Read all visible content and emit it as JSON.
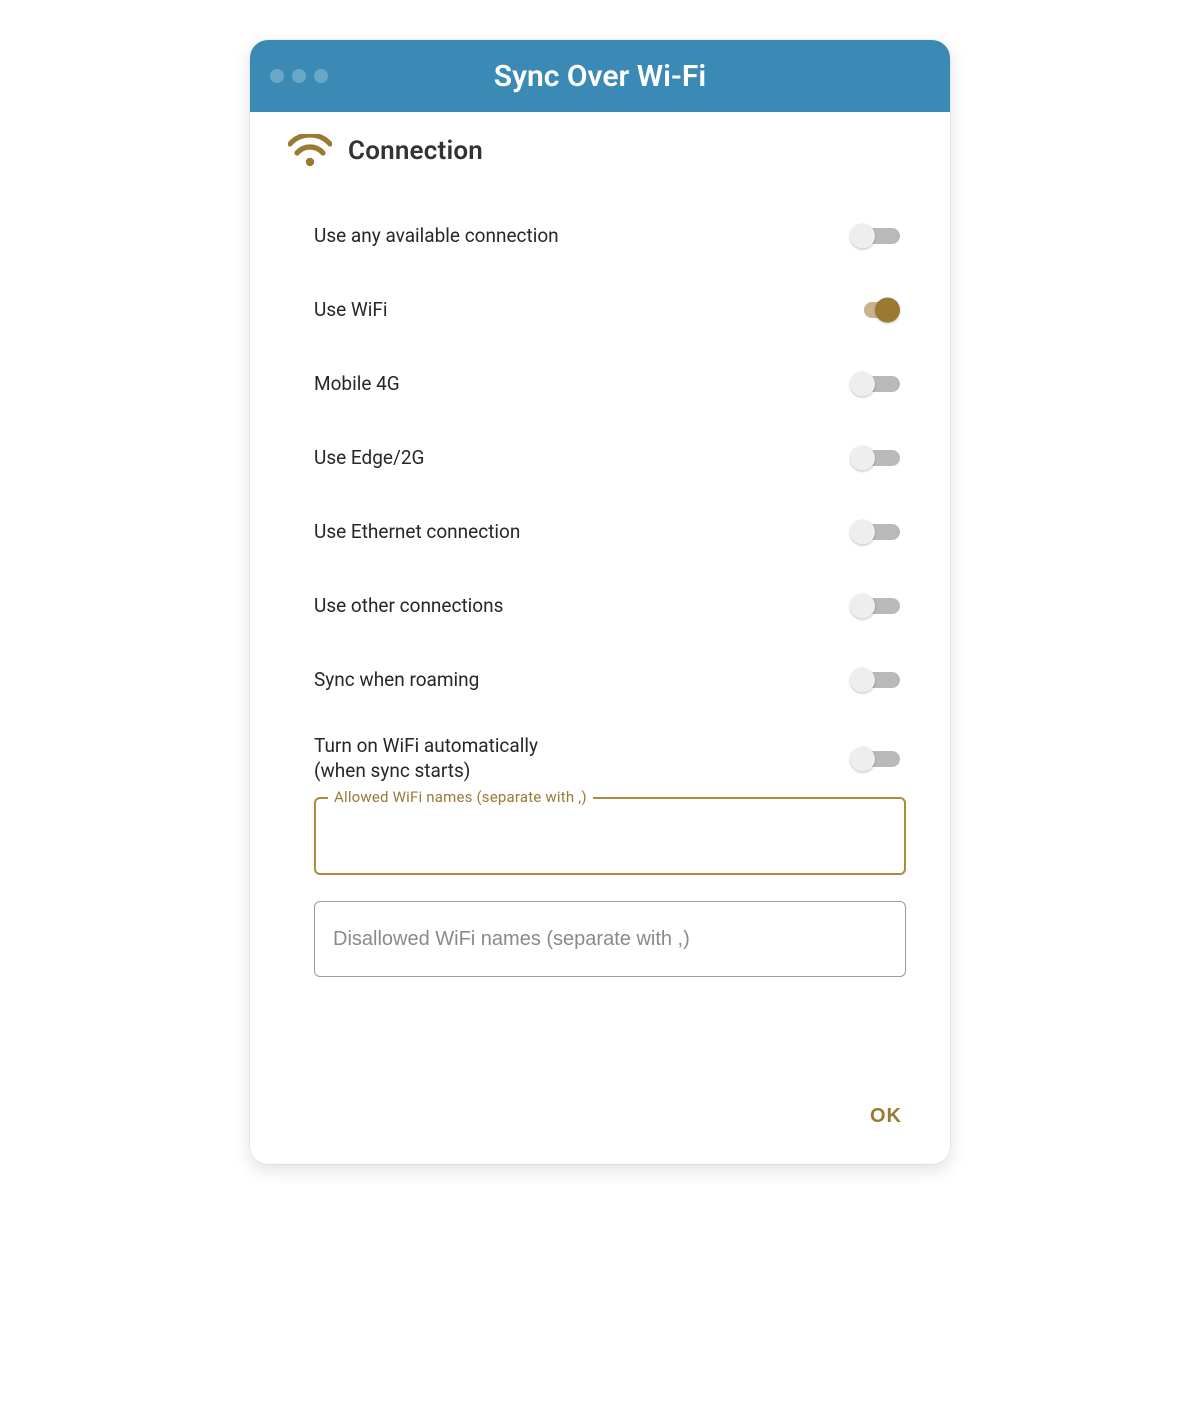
{
  "window": {
    "title": "Sync Over Wi-Fi",
    "accent_color": "#3b8ab5"
  },
  "section": {
    "title": "Connection",
    "icon_color": "#9a7a33"
  },
  "toggles": [
    {
      "name": "use-any-connection",
      "label": "Use any available connection",
      "on": false
    },
    {
      "name": "use-wifi",
      "label": "Use WiFi",
      "on": true
    },
    {
      "name": "mobile-4g",
      "label": "Mobile 4G",
      "on": false
    },
    {
      "name": "use-edge-2g",
      "label": "Use Edge/2G",
      "on": false
    },
    {
      "name": "use-ethernet",
      "label": "Use Ethernet connection",
      "on": false
    },
    {
      "name": "use-other",
      "label": "Use other connections",
      "on": false
    },
    {
      "name": "sync-roaming",
      "label": "Sync when roaming",
      "on": false
    },
    {
      "name": "auto-wifi",
      "label": "Turn on WiFi automatically",
      "sublabel": "(when sync starts)",
      "on": false
    }
  ],
  "fields": {
    "allowed": {
      "label": "Allowed WiFi names (separate with ,)",
      "value": ""
    },
    "disallowed": {
      "placeholder": "Disallowed WiFi names (separate with ,)",
      "value": ""
    }
  },
  "footer": {
    "ok_label": "OK"
  }
}
